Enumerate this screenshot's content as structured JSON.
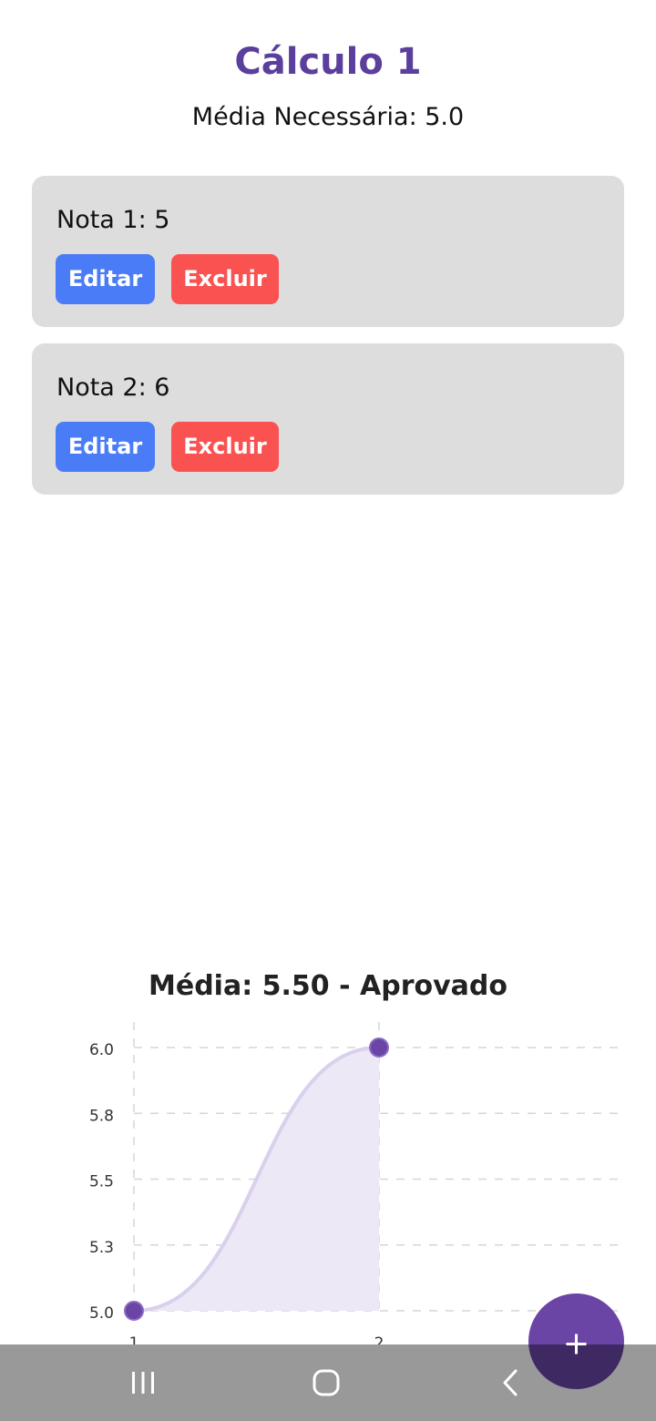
{
  "header": {
    "title": "Cálculo 1",
    "required_average": "Média Necessária: 5.0"
  },
  "grades": [
    {
      "label": "Nota 1: 5",
      "edit_label": "Editar",
      "delete_label": "Excluir"
    },
    {
      "label": "Nota 2: 6",
      "edit_label": "Editar",
      "delete_label": "Excluir"
    }
  ],
  "chart_title": "Média: 5.50 - Aprovado",
  "chart_data": {
    "type": "area",
    "x": [
      1,
      2
    ],
    "values": [
      5,
      6
    ],
    "x_tick_labels": [
      "1",
      "2"
    ],
    "y_tick_labels": [
      "6.0",
      "5.8",
      "5.5",
      "5.3",
      "5.0"
    ],
    "y_tick_values": [
      6.0,
      5.75,
      5.5,
      5.25,
      5.0
    ],
    "ylim": [
      5.0,
      6.0
    ],
    "grid": true,
    "color": "#6a45a6",
    "fill_color": "#ece8f5"
  },
  "fab": {
    "icon": "plus-icon"
  },
  "navbar": {
    "recents_icon": "recents-icon",
    "home_icon": "home-icon",
    "back_icon": "back-icon"
  },
  "colors": {
    "primary": "#5b3f9c",
    "edit_button": "#4a7cf7",
    "delete_button": "#fa5151",
    "card_background": "#dddddd"
  }
}
